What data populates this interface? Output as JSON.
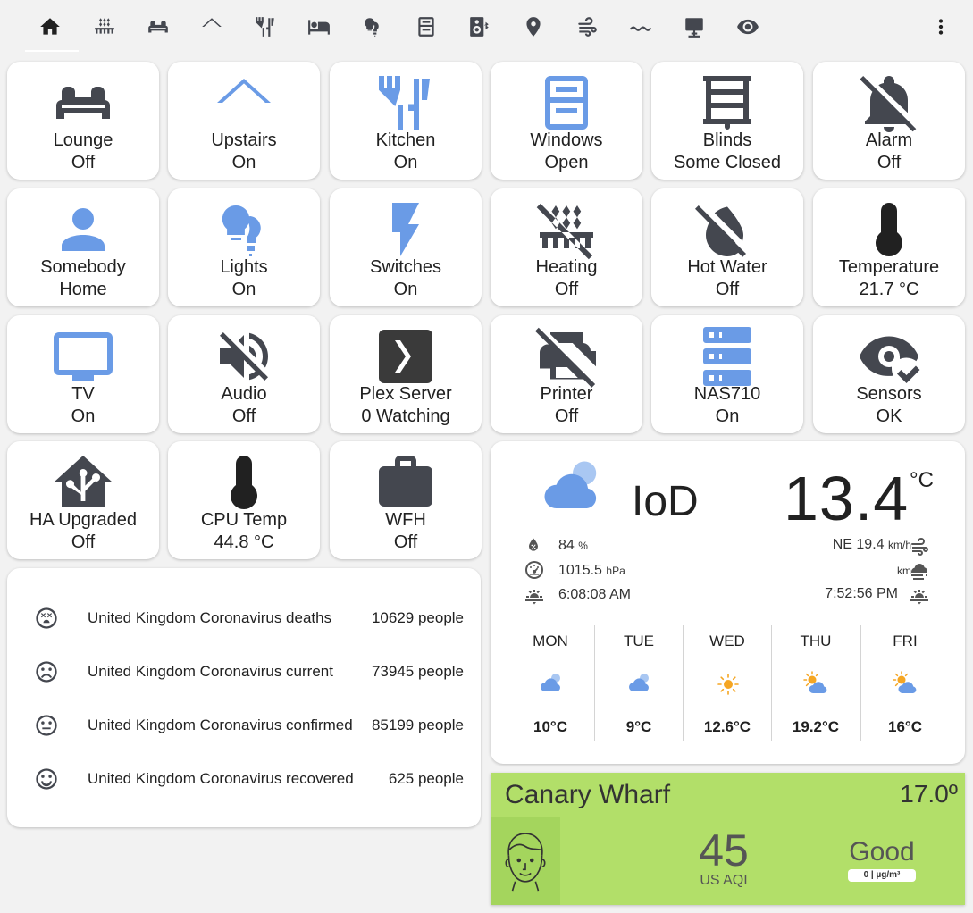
{
  "colors": {
    "active_icon": "#6a9be6",
    "inactive_icon": "#44474f",
    "aqi_background": "#b2df69"
  },
  "tabs": [
    {
      "icon": "home-icon"
    },
    {
      "icon": "radiator-icon"
    },
    {
      "icon": "sofa-icon"
    },
    {
      "icon": "roof-icon"
    },
    {
      "icon": "silverware-icon"
    },
    {
      "icon": "bed-icon"
    },
    {
      "icon": "lightbulb-group-icon"
    },
    {
      "icon": "window-icon"
    },
    {
      "icon": "speaker-bluetooth-icon"
    },
    {
      "icon": "map-marker-icon"
    },
    {
      "icon": "weather-windy-icon"
    },
    {
      "icon": "water-icon"
    },
    {
      "icon": "desktop-tower-icon"
    },
    {
      "icon": "eye-icon"
    }
  ],
  "buttons": [
    {
      "name": "Lounge",
      "state": "Off",
      "icon": "sofa-icon"
    },
    {
      "name": "Upstairs",
      "state": "On",
      "icon": "roof-icon"
    },
    {
      "name": "Kitchen",
      "state": "On",
      "icon": "silverware-icon"
    },
    {
      "name": "Windows",
      "state": "Open",
      "icon": "window-icon"
    },
    {
      "name": "Blinds",
      "state": "Some Closed",
      "icon": "blinds-icon"
    },
    {
      "name": "Alarm",
      "state": "Off",
      "icon": "bell-off-icon"
    },
    {
      "name": "Somebody",
      "state": "Home",
      "icon": "account-icon"
    },
    {
      "name": "Lights",
      "state": "On",
      "icon": "lightbulb-group-icon"
    },
    {
      "name": "Switches",
      "state": "On",
      "icon": "flash-icon"
    },
    {
      "name": "Heating",
      "state": "Off",
      "icon": "radiator-off-icon"
    },
    {
      "name": "Hot Water",
      "state": "Off",
      "icon": "water-off-icon"
    },
    {
      "name": "Temperature",
      "state": "21.7 °C",
      "icon": "thermometer-icon"
    },
    {
      "name": "TV",
      "state": "On",
      "icon": "television-icon"
    },
    {
      "name": "Audio",
      "state": "Off",
      "icon": "volume-off-icon"
    },
    {
      "name": "Plex Server",
      "state": "0 Watching",
      "icon": "plex-icon"
    },
    {
      "name": "Printer",
      "state": "Off",
      "icon": "printer-off-icon"
    },
    {
      "name": "NAS710",
      "state": "On",
      "icon": "server-icon"
    },
    {
      "name": "Sensors",
      "state": "OK",
      "icon": "eye-check-icon"
    },
    {
      "name": "HA Upgraded",
      "state": "Off",
      "icon": "home-assistant-icon"
    },
    {
      "name": "CPU Temp",
      "state": "44.8 °C",
      "icon": "thermometer-icon"
    },
    {
      "name": "WFH",
      "state": "Off",
      "icon": "briefcase-icon"
    }
  ],
  "corona": [
    {
      "label": "United Kingdom Coronavirus deaths",
      "value": "10629 people",
      "icon": "emoticon-dead-icon"
    },
    {
      "label": "United Kingdom Coronavirus current",
      "value": "73945 people",
      "icon": "emoticon-sad-icon"
    },
    {
      "label": "United Kingdom Coronavirus confirmed",
      "value": "85199 people",
      "icon": "emoticon-neutral-icon"
    },
    {
      "label": "United Kingdom Coronavirus recovered",
      "value": "625 people",
      "icon": "emoticon-happy-icon"
    }
  ],
  "weather": {
    "location": "IoD",
    "temperature": "13.4",
    "unit": "°C",
    "humidity": "84",
    "humidity_unit": "%",
    "pressure": "1015.5",
    "pressure_unit": "hPa",
    "sunrise": "6:08:08 AM",
    "wind": "NE 19.4",
    "wind_unit": "km/h",
    "visibility_unit": "km",
    "sunset": "7:52:56 PM",
    "forecast": [
      {
        "day": "MON",
        "temp": "10°C",
        "icon": "cloudy-icon"
      },
      {
        "day": "TUE",
        "temp": "9°C",
        "icon": "cloudy-icon"
      },
      {
        "day": "WED",
        "temp": "12.6°C",
        "icon": "sunny-icon"
      },
      {
        "day": "THU",
        "temp": "19.2°C",
        "icon": "partly-cloudy-icon"
      },
      {
        "day": "FRI",
        "temp": "16°C",
        "icon": "partly-cloudy-icon"
      }
    ]
  },
  "aqi": {
    "location": "Canary Wharf",
    "temperature": "17.0º",
    "value": "45",
    "label": "US AQI",
    "status": "Good",
    "pm": "0 | µg/m³"
  }
}
